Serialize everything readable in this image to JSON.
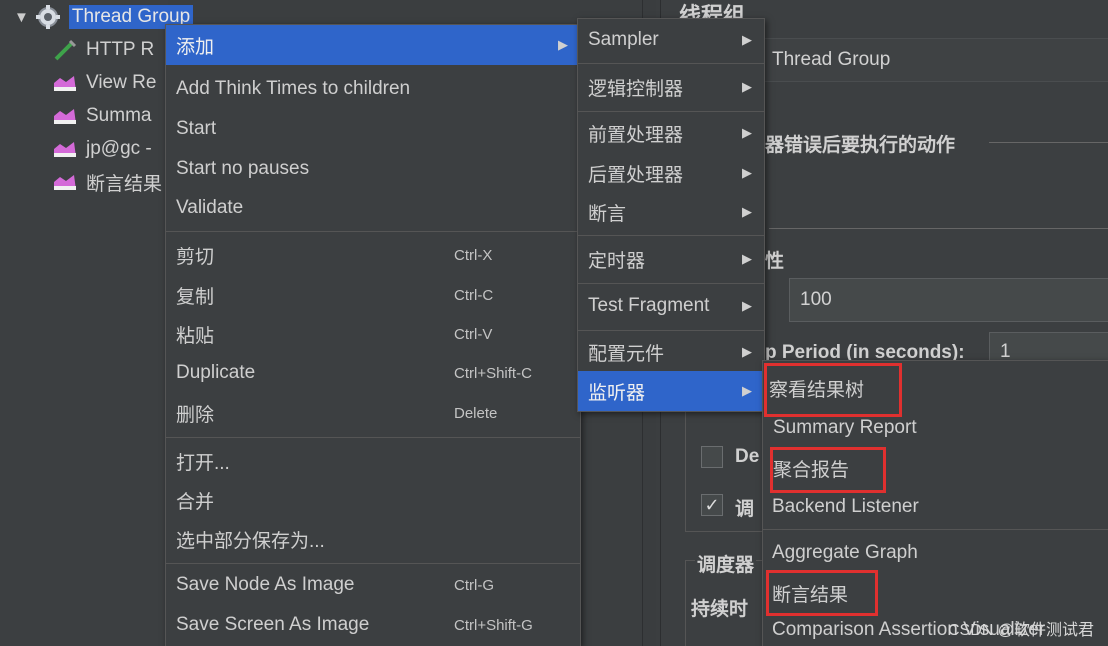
{
  "tree": {
    "root_label": "Thread Group",
    "items": [
      {
        "label": "HTTP R",
        "icon": "pipette-icon"
      },
      {
        "label": "View Re",
        "icon": "listener-graph-icon"
      },
      {
        "label": "Summa",
        "icon": "listener-graph-icon"
      },
      {
        "label": "jp@gc -",
        "icon": "listener-graph-icon"
      },
      {
        "label": "断言结果",
        "icon": "listener-graph-icon"
      }
    ]
  },
  "context_menu": {
    "add": "添加",
    "add_think_times": "Add Think Times to children",
    "start": "Start",
    "start_no_pauses": "Start no pauses",
    "validate": "Validate",
    "cut": "剪切",
    "cut_sc": "Ctrl-X",
    "copy": "复制",
    "copy_sc": "Ctrl-C",
    "paste": "粘贴",
    "paste_sc": "Ctrl-V",
    "duplicate": "Duplicate",
    "duplicate_sc": "Ctrl+Shift-C",
    "delete": "删除",
    "delete_sc": "Delete",
    "open": "打开...",
    "merge": "合并",
    "save_selection_as": "选中部分保存为...",
    "save_node_as_image": "Save Node As Image",
    "save_node_sc": "Ctrl-G",
    "save_screen_as_image": "Save Screen As Image",
    "save_screen_sc": "Ctrl+Shift-G"
  },
  "add_submenu": {
    "sampler": "Sampler",
    "logic_controller": "逻辑控制器",
    "pre_processor": "前置处理器",
    "post_processor": "后置处理器",
    "assertion": "断言",
    "timer": "定时器",
    "test_fragment": "Test Fragment",
    "config_element": "配置元件",
    "listener": "监听器"
  },
  "listener_submenu": {
    "view_results_tree": "察看结果树",
    "summary_report": "Summary Report",
    "aggregate_report": "聚合报告",
    "backend_listener": "Backend Listener",
    "aggregate_graph": "Aggregate Graph",
    "assertion_results": "断言结果",
    "comparison_assertion": "Comparison Assertion Visualizer"
  },
  "right_panel": {
    "heading": "线程组",
    "name_value": "Thread Group",
    "on_error_label": "器错误后要执行的动作",
    "threads_label": "性",
    "threads_value": "100",
    "ramp_label": "p Period (in seconds):",
    "ramp_value": "1",
    "delay_check_label": "De",
    "scheduler_check_label": "调",
    "scheduler_label": "调度器",
    "duration_label": "持续时"
  },
  "watermark": "CSDN @软件测试君",
  "colors": {
    "selection": "#2f65ca",
    "highlight_box": "#e0302f",
    "background": "#3c3f41"
  }
}
